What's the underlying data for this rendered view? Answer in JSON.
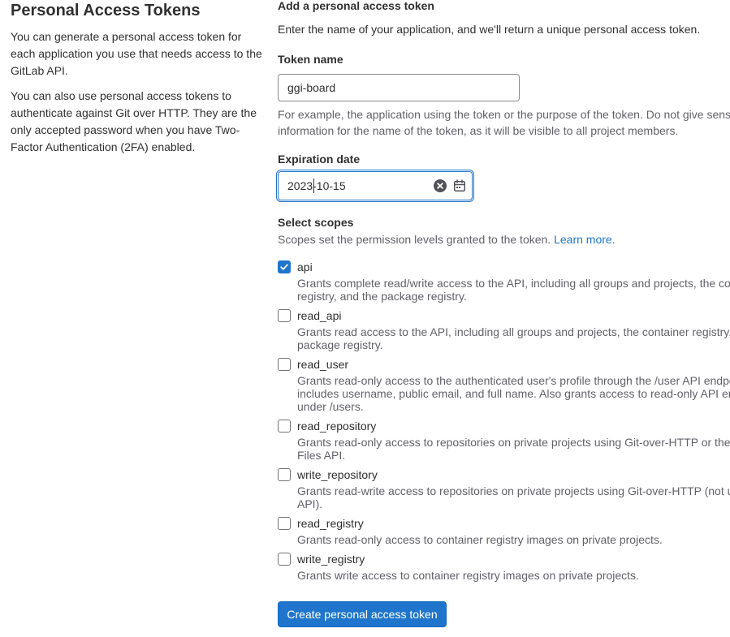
{
  "sidebar": {
    "title": "Personal Access Tokens",
    "paragraph1": "You can generate a personal access token for each application you use that needs access to the GitLab API.",
    "paragraph2": "You can also use personal access tokens to authenticate against Git over HTTP. They are the only accepted password when you have Two-Factor Authentication (2FA) enabled."
  },
  "form": {
    "title": "Add a personal access token",
    "description": "Enter the name of your application, and we'll return a unique personal access token.",
    "token_name": {
      "label": "Token name",
      "value": "ggi-board",
      "help_line1": "For example, the application using the token or the purpose of the token. Do not give sensitive",
      "help_line2": "information for the name of the token, as it will be visible to all project members."
    },
    "expiration": {
      "label": "Expiration date",
      "value": "2023-10-15",
      "clear_icon": "clear-icon",
      "calendar_icon": "calendar-icon"
    },
    "scopes": {
      "label": "Select scopes",
      "description": "Scopes set the permission levels granted to the token.",
      "learn_more": "Learn more.",
      "items": [
        {
          "name": "api",
          "checked": true,
          "desc_lines": [
            "Grants complete read/write access to the API, including all groups and projects, the container",
            "registry, and the package registry."
          ]
        },
        {
          "name": "read_api",
          "checked": false,
          "desc_lines": [
            "Grants read access to the API, including all groups and projects, the container registry, and the",
            "package registry."
          ]
        },
        {
          "name": "read_user",
          "checked": false,
          "desc_lines": [
            "Grants read-only access to the authenticated user's profile through the /user API endpoint, which",
            "includes username, public email, and full name. Also grants access to read-only API endpoints",
            "under /users."
          ]
        },
        {
          "name": "read_repository",
          "checked": false,
          "desc_lines": [
            "Grants read-only access to repositories on private projects using Git-over-HTTP or the Repository",
            "Files API."
          ]
        },
        {
          "name": "write_repository",
          "checked": false,
          "desc_lines": [
            "Grants read-write access to repositories on private projects using Git-over-HTTP (not using the",
            "API)."
          ]
        },
        {
          "name": "read_registry",
          "checked": false,
          "desc_lines": [
            "Grants read-only access to container registry images on private projects."
          ]
        },
        {
          "name": "write_registry",
          "checked": false,
          "desc_lines": [
            "Grants write access to container registry images on private projects."
          ]
        }
      ]
    },
    "submit_label": "Create personal access token"
  },
  "colors": {
    "accent": "#1f75cb",
    "text": "#303030",
    "muted": "#626168"
  }
}
